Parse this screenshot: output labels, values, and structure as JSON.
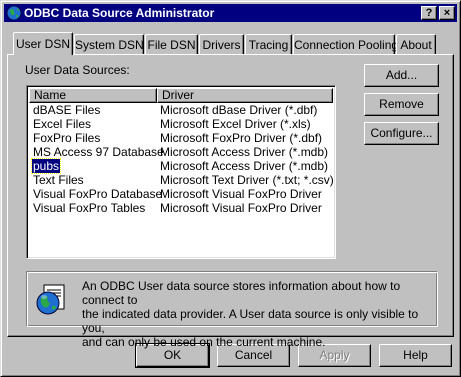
{
  "window": {
    "title": "ODBC Data Source Administrator",
    "title_buttons": {
      "help": "?",
      "close": "×"
    }
  },
  "tabs": [
    {
      "label": "User DSN",
      "active": true
    },
    {
      "label": "System DSN"
    },
    {
      "label": "File DSN"
    },
    {
      "label": "Drivers"
    },
    {
      "label": "Tracing"
    },
    {
      "label": "Connection Pooling"
    },
    {
      "label": "About"
    }
  ],
  "main": {
    "list_label": "User Data Sources:",
    "columns": {
      "name": "Name",
      "driver": "Driver"
    },
    "rows": [
      {
        "name": "dBASE Files",
        "driver": "Microsoft dBase Driver (*.dbf)"
      },
      {
        "name": "Excel Files",
        "driver": "Microsoft Excel Driver (*.xls)"
      },
      {
        "name": "FoxPro Files",
        "driver": "Microsoft FoxPro Driver (*.dbf)"
      },
      {
        "name": "MS Access 97 Database",
        "driver": "Microsoft Access Driver (*.mdb)"
      },
      {
        "name": "pubs",
        "driver": "Microsoft Access Driver (*.mdb)",
        "selected": true
      },
      {
        "name": "Text Files",
        "driver": "Microsoft Text Driver (*.txt; *.csv)"
      },
      {
        "name": "Visual FoxPro Database",
        "driver": "Microsoft Visual FoxPro Driver"
      },
      {
        "name": "Visual FoxPro Tables",
        "driver": "Microsoft Visual FoxPro Driver"
      }
    ],
    "info_text": "An ODBC User data source stores information about how to connect to\nthe indicated data provider.   A User data source is only visible to you,\nand can only be used on the current machine."
  },
  "side_buttons": {
    "add": "Add...",
    "remove": "Remove",
    "configure": "Configure..."
  },
  "bottom_buttons": {
    "ok": "OK",
    "cancel": "Cancel",
    "apply": "Apply",
    "help": "Help"
  },
  "colors": {
    "face": "#c0c0c0",
    "title_bar": "#000080",
    "selection": "#000080",
    "list_bg": "#ffffff"
  },
  "icons": {
    "title": "odbc-globe-icon",
    "info": "globe-document-icon"
  }
}
